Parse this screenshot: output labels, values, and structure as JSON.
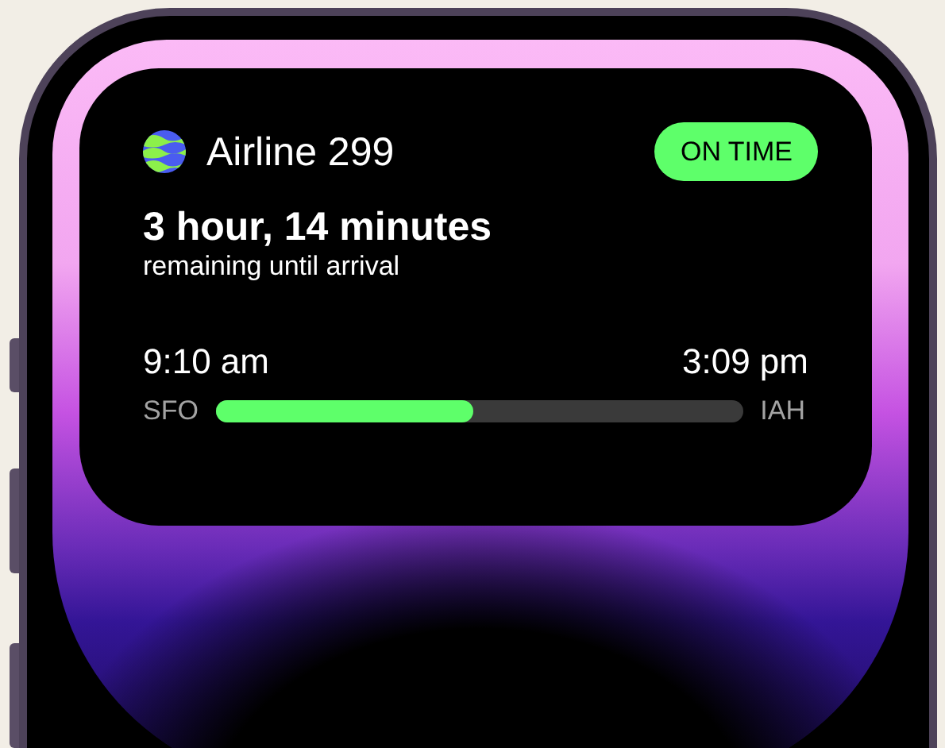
{
  "activity": {
    "airline": "Airline 299",
    "status": "ON TIME",
    "remaining": "3 hour, 14 minutes",
    "remaining_caption": "remaining until arrival",
    "departure_time": "9:10 am",
    "arrival_time": "3:09 pm",
    "origin": "SFO",
    "destination": "IAH",
    "level": 0.49
  }
}
